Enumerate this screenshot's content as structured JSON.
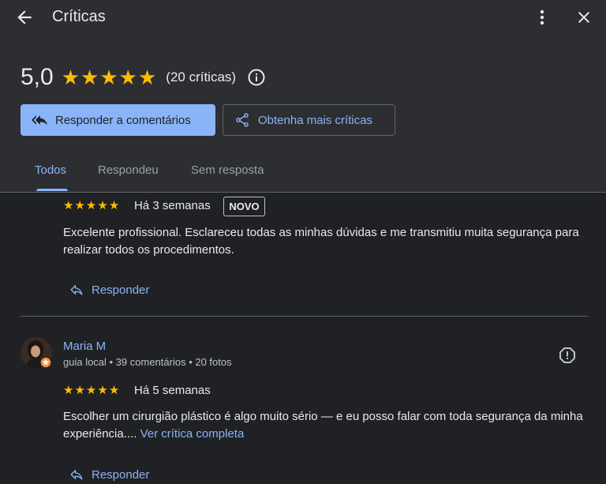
{
  "header": {
    "title": "Críticas",
    "rating": "5,0",
    "stars": 5,
    "review_count": "(20 críticas)",
    "reply_button": "Responder a comentários",
    "get_more_button": "Obtenha mais críticas"
  },
  "tabs": [
    {
      "label": "Todos",
      "active": true
    },
    {
      "label": "Respondeu",
      "active": false
    },
    {
      "label": "Sem resposta",
      "active": false
    }
  ],
  "reviews": [
    {
      "stars": 5,
      "time": "Há 3 semanas",
      "badge": "NOVO",
      "text": "Excelente profissional. Esclareceu todas as minhas dúvidas e me transmitiu muita segurança para realizar todos os procedimentos.",
      "reply_label": "Responder"
    },
    {
      "author": "Maria M",
      "meta": "guia local • 39 comentários • 20 fotos",
      "stars": 5,
      "time": "Há 5 semanas",
      "text": "Escolher um cirurgião plástico é algo muito sério — e eu posso falar com toda segurança da minha experiência....",
      "see_more": "Ver crítica completa",
      "reply_label": "Responder"
    }
  ],
  "colors": {
    "background": "#202124",
    "header_bg": "#2d2e31",
    "accent": "#8ab4f8",
    "star": "#fbbc04"
  },
  "icons": [
    "back-arrow-icon",
    "more-vert-icon",
    "close-icon",
    "info-icon",
    "reply-all-icon",
    "share-icon",
    "reply-icon",
    "report-icon",
    "local-guide-badge-icon"
  ]
}
